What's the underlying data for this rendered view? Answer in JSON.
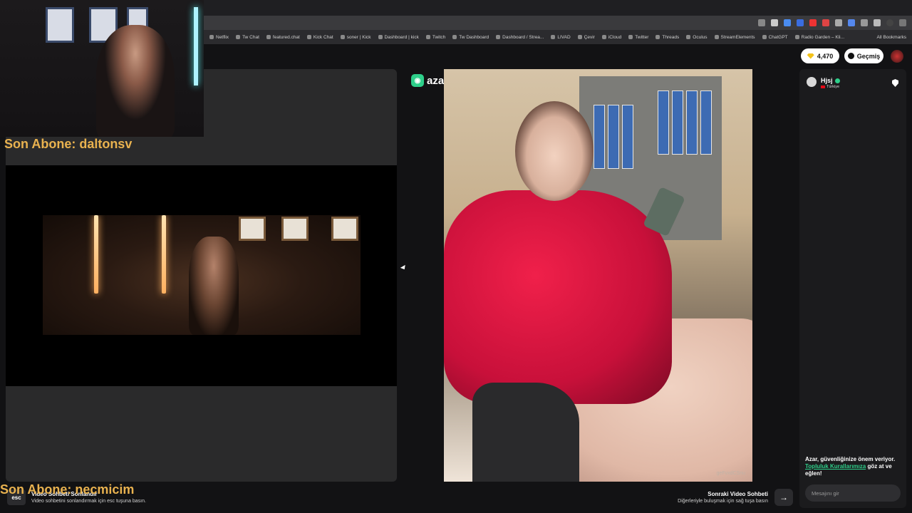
{
  "browser": {
    "bookmarks": [
      "Netflix",
      "Tw Chat",
      "featured.chat",
      "Kick Chat",
      "soner | Kick",
      "Dashboard | kick",
      "Twitch",
      "Tw Dashboard",
      "Dashboard / Strea...",
      "LIVAD",
      "Çevir",
      "iCloud",
      "Twitter",
      "Threads",
      "Oculus",
      "StreamElements",
      "ChatGPT",
      "Radio Garden – Kli..."
    ],
    "all_bookmarks_label": "All Bookmarks"
  },
  "overlay": {
    "last_sub_top": "Son Abone: daltonsv",
    "last_sub_bottom": "Son Abone: necmicim"
  },
  "azar": {
    "logo_text": "azar",
    "coins": "4,470",
    "history_label": "Geçmiş",
    "remote_video_id": "geFvxdCSnu"
  },
  "chat": {
    "user_name": "Hjsj",
    "user_country": "Türkiye",
    "safety_text_before": "Azar, güvenliğinize önem veriyor.",
    "safety_link": "Topluluk Kurallarımıza",
    "safety_text_after": "göz at ve eğlen!",
    "input_placeholder": "Mesajını gir"
  },
  "bottom_bar": {
    "esc_label": "esc",
    "end_title": "Video Sohbeti Sonlandır",
    "end_subtitle": "Video sohbetini sonlandırmak için esc tuşuna basın.",
    "next_title": "Sonraki Video Sohbeti",
    "next_subtitle": "Diğerleriyle buluşmak için sağ tuşa basın",
    "next_arrow": "→"
  },
  "colors": {
    "brand_green": "#2ecf8a",
    "sub_text_gold": "#e9b24f",
    "jacket_red": "#e0163f"
  }
}
